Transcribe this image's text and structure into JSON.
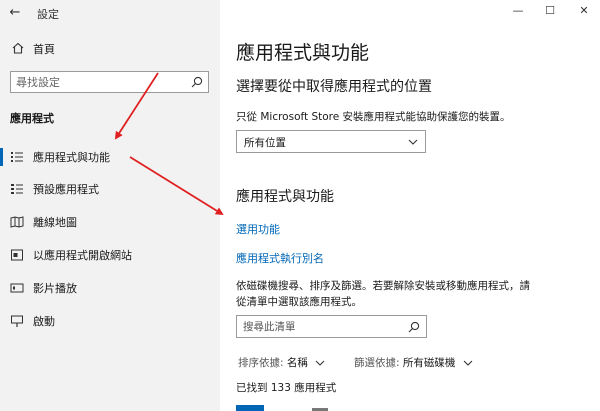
{
  "window": {
    "title": "設定",
    "controls": {
      "minimize": "—",
      "maximize": "☐",
      "close": "✕"
    }
  },
  "sidebar": {
    "back_glyph": "←",
    "home_label": "首頁",
    "search_placeholder": "尋找設定",
    "section_label": "應用程式",
    "items": [
      {
        "label": "應用程式與功能",
        "icon": "apps-features-icon",
        "active": true
      },
      {
        "label": "預設應用程式",
        "icon": "default-apps-icon",
        "active": false
      },
      {
        "label": "離線地圖",
        "icon": "offline-maps-icon",
        "active": false
      },
      {
        "label": "以應用程式開啟網站",
        "icon": "apps-for-websites-icon",
        "active": false
      },
      {
        "label": "影片播放",
        "icon": "video-playback-icon",
        "active": false
      },
      {
        "label": "啟動",
        "icon": "startup-icon",
        "active": false
      }
    ]
  },
  "main": {
    "page_title": "應用程式與功能",
    "install_section": {
      "title": "選擇要從中取得應用程式的位置",
      "description": "只從 Microsoft Store 安裝應用程式能協助保護您的裝置。",
      "select_value": "所有位置"
    },
    "apps_section": {
      "title": "應用程式與功能",
      "link_optional_features": "選用功能",
      "link_app_aliases": "應用程式執行別名",
      "description": "依磁碟機搜尋、排序及篩選。若要解除安裝或移動應用程式，請從清單中選取該應用程式。",
      "search_placeholder": "搜尋此清單",
      "sort_label": "排序依據:",
      "sort_value": "名稱",
      "filter_label": "篩選依據:",
      "filter_value": "所有磁碟機",
      "found_text": "已找到 133 應用程式"
    }
  },
  "colors": {
    "accent": "#0067b8",
    "sidebar_bg": "#f2f2f2",
    "annotation_arrow": "#e02020"
  }
}
